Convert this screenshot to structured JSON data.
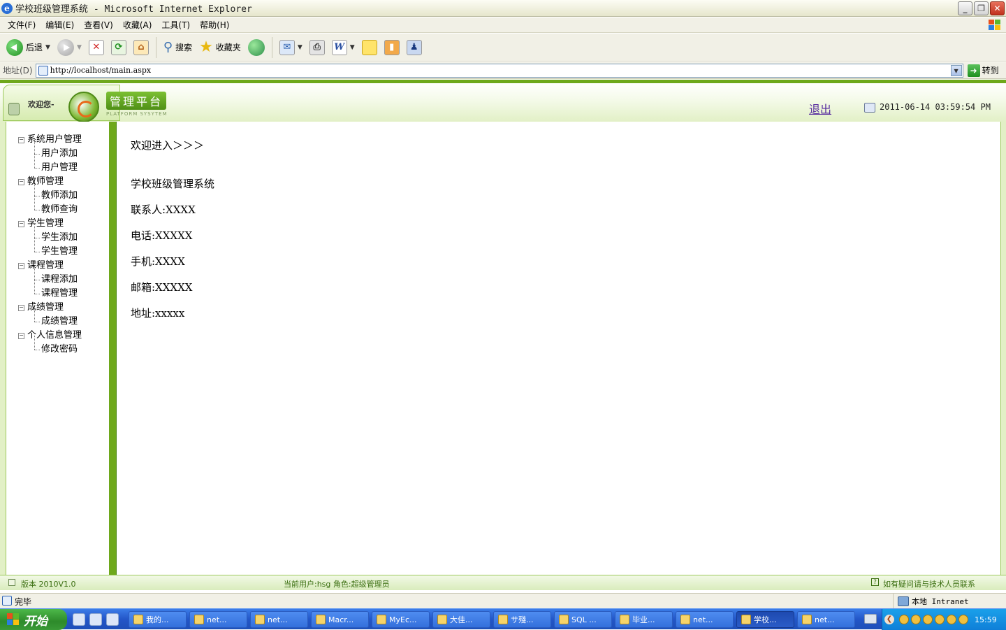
{
  "window": {
    "title": "学校班级管理系统 - Microsoft Internet Explorer",
    "buttons": {
      "minimize": "_",
      "maximize": "❐",
      "close": "✕"
    }
  },
  "menubar": {
    "items": [
      "文件(F)",
      "编辑(E)",
      "查看(V)",
      "收藏(A)",
      "工具(T)",
      "帮助(H)"
    ]
  },
  "toolbar": {
    "back": "后退",
    "search": "搜索",
    "favorites": "收藏夹",
    "icons": [
      "back-icon",
      "forward-icon",
      "stop-icon",
      "refresh-icon",
      "home-icon",
      "search-icon",
      "favorites-star-icon",
      "history-icon",
      "mail-icon",
      "print-icon",
      "word-icon",
      "note-icon",
      "book-icon",
      "messenger-icon"
    ]
  },
  "addressbar": {
    "label": "地址(D)",
    "url": "http://localhost/main.aspx",
    "go": "转到"
  },
  "app_header": {
    "welcome": "欢迎您-",
    "brand_title": "管理平台",
    "brand_sub": "PLATFORM SYSYTEM",
    "logout": "退出",
    "datetime": "2011-06-14 03:59:54 PM"
  },
  "sidebar": {
    "groups": [
      {
        "label": "系统用户管理",
        "items": [
          "用户添加",
          "用户管理"
        ]
      },
      {
        "label": "教师管理",
        "items": [
          "教师添加",
          "教师查询"
        ]
      },
      {
        "label": "学生管理",
        "items": [
          "学生添加",
          "学生管理"
        ]
      },
      {
        "label": "课程管理",
        "items": [
          "课程添加",
          "课程管理"
        ]
      },
      {
        "label": "成绩管理",
        "items": [
          "成绩管理"
        ]
      },
      {
        "label": "个人信息管理",
        "items": [
          "修改密码"
        ]
      }
    ],
    "toggle": "−"
  },
  "content": {
    "welcome": "欢迎进入＞＞＞",
    "system_name": "学校班级管理系统",
    "contact": "联系人:XXXX",
    "phone": "电话:XXXXX",
    "mobile": "手机:XXXX",
    "email": "邮箱:XXXXX",
    "address": "地址:xxxxx"
  },
  "app_status": {
    "version": "版本 2010V1.0",
    "current_user": "当前用户:hsg 角色:超级管理员",
    "contact": "如有疑问请与技术人员联系",
    "help_icon": "?"
  },
  "ie_status": {
    "done": "完毕",
    "zone": "本地 Intranet"
  },
  "taskbar": {
    "start": "开始",
    "tasks": [
      "我的...",
      "net...",
      "net...",
      "Macr...",
      "MyEc...",
      "大佳...",
      "サ殘...",
      "SQL ...",
      "毕业...",
      "net...",
      "学校...",
      "net..."
    ],
    "active_index": 10,
    "time": "15:59"
  }
}
